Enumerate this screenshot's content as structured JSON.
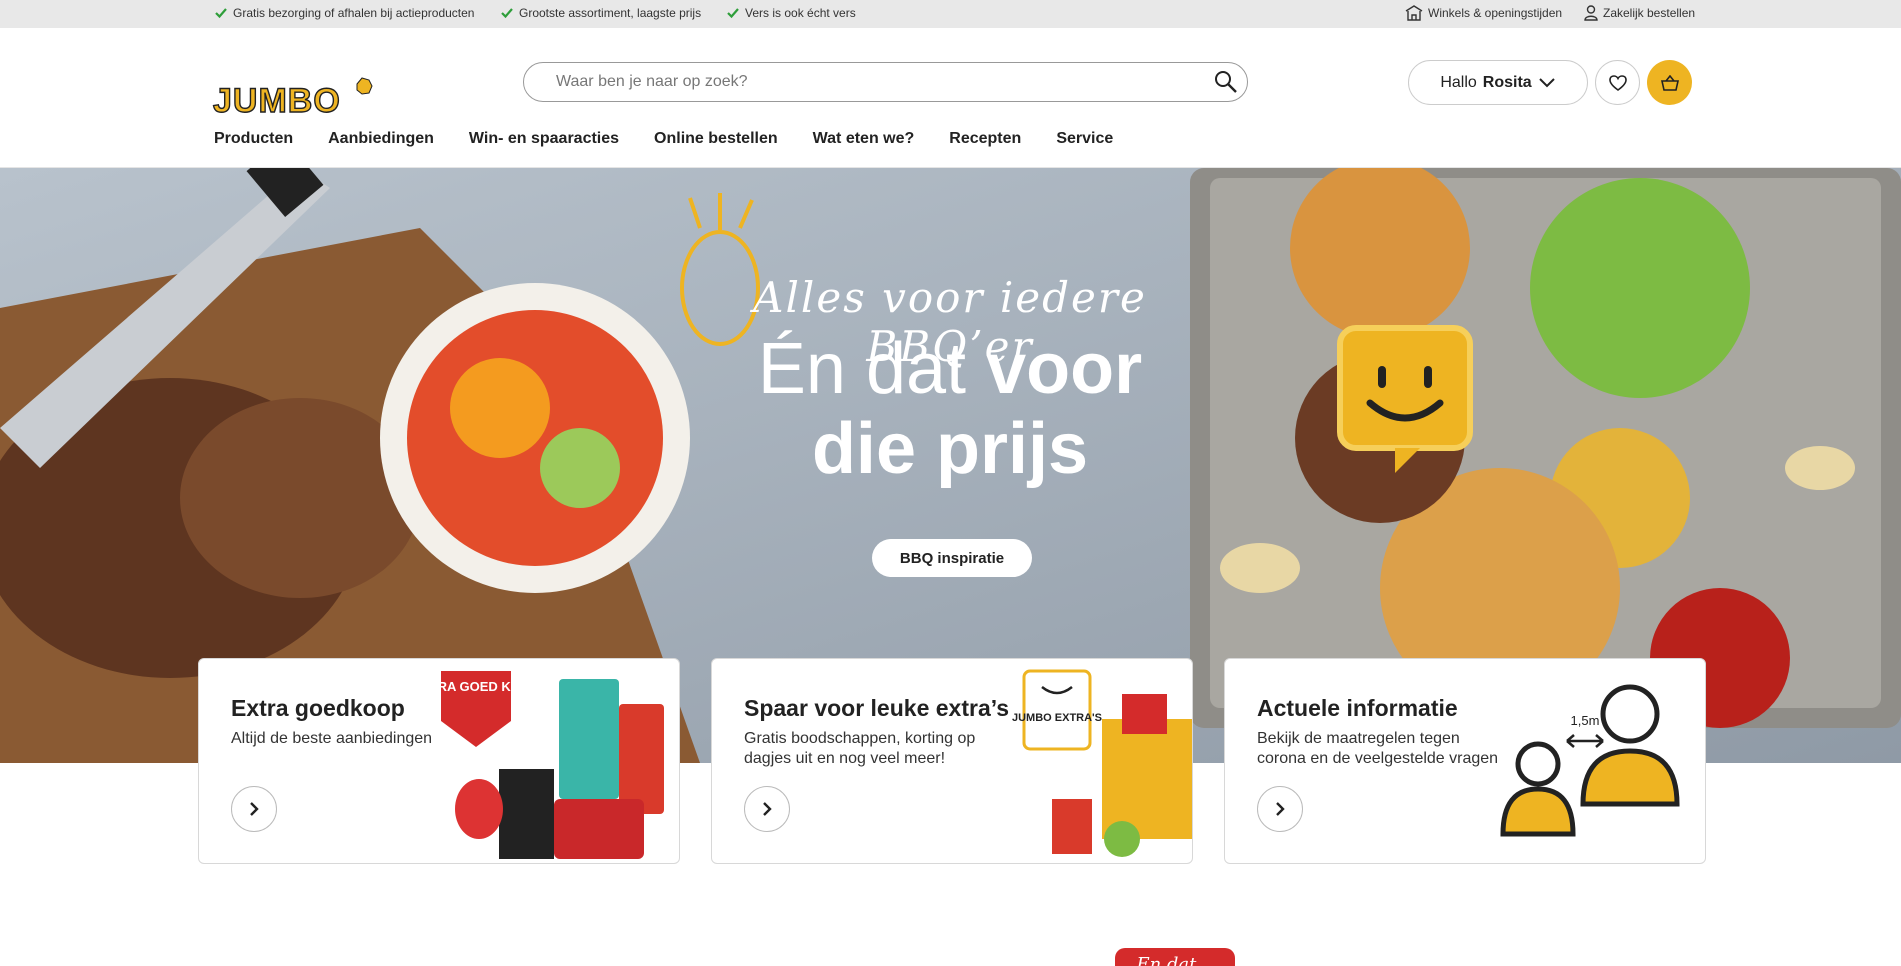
{
  "topbar": {
    "usps": [
      "Gratis bezorging of afhalen bij actieproducten",
      "Grootste assortiment, laagste prijs",
      "Vers is ook écht vers"
    ],
    "stores_link": "Winkels & openingstijden",
    "business_link": "Zakelijk bestellen"
  },
  "header": {
    "logo_text": "JUMBO",
    "search_placeholder": "Waar ben je naar op zoek?",
    "greeting": "Hallo",
    "user_name": "Rosita"
  },
  "nav": [
    "Producten",
    "Aanbiedingen",
    "Win- en spaaracties",
    "Online bestellen",
    "Wat eten we?",
    "Recepten",
    "Service"
  ],
  "hero": {
    "script_line": "Alles voor iedere BBQ’er",
    "line2_light": "Én dat",
    "line2_bold": "voor",
    "line3": "die prijs",
    "button": "BBQ inspiratie"
  },
  "cards": [
    {
      "title": "Extra goedkoop",
      "text": "Altijd de beste aanbiedingen",
      "badge": "EXTRA GOED KOOP"
    },
    {
      "title": "Spaar voor leuke extra’s",
      "text": "Gratis boodschappen, korting op dagjes uit en nog veel meer!",
      "badge": "JUMBO EXTRA'S"
    },
    {
      "title": "Actuele informatie",
      "text": "Bekijk de maatregelen tegen corona en de veelgestelde vragen",
      "badge": "1,5m"
    }
  ],
  "bottom_badge": "En dat...",
  "colors": {
    "brand_yellow": "#eeb422",
    "check_green": "#2e9e3a",
    "accent_red": "#d42b2b"
  }
}
